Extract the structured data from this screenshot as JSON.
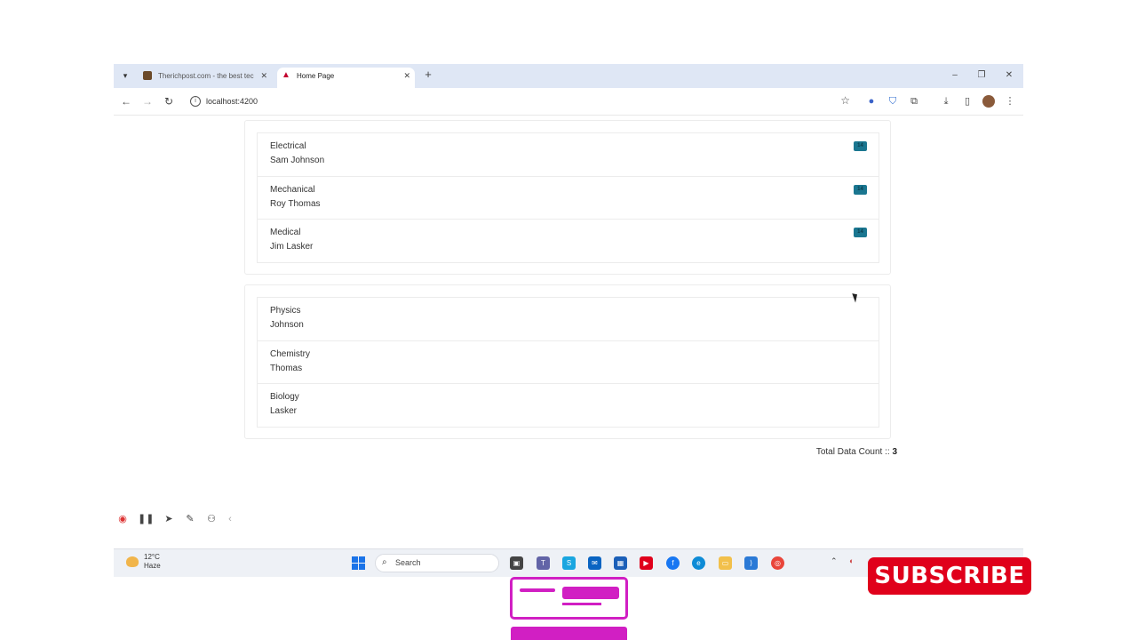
{
  "browser": {
    "tabs": [
      {
        "title": "Therichpost.com - the best tec"
      },
      {
        "title": "Home Page"
      }
    ],
    "url": "localhost:4200"
  },
  "cards": [
    {
      "items": [
        {
          "line1": "Electrical",
          "line2": "Sam Johnson",
          "badge": "14"
        },
        {
          "line1": "Mechanical",
          "line2": "Roy Thomas",
          "badge": "14"
        },
        {
          "line1": "Medical",
          "line2": "Jim Lasker",
          "badge": "14"
        }
      ]
    },
    {
      "items": [
        {
          "line1": "Physics",
          "line2": "Johnson"
        },
        {
          "line1": "Chemistry",
          "line2": "Thomas"
        },
        {
          "line1": "Biology",
          "line2": "Lasker"
        }
      ]
    }
  ],
  "total": {
    "label": "Total Data Count :: ",
    "value": "3"
  },
  "taskbar": {
    "temperature": "12°C",
    "condition": "Haze",
    "search_label": "Search"
  },
  "overlay": {
    "subscribe": "SUBSCRIBE"
  },
  "colors": {
    "accent_badge": "#1a7690",
    "subscribe": "#e0001b",
    "pink": "#d11fc3"
  },
  "icons": [
    "back-icon",
    "forward-icon",
    "reload-icon",
    "info-icon",
    "star-icon",
    "download-icon",
    "menu-icon",
    "windows-icon",
    "search-icon"
  ]
}
